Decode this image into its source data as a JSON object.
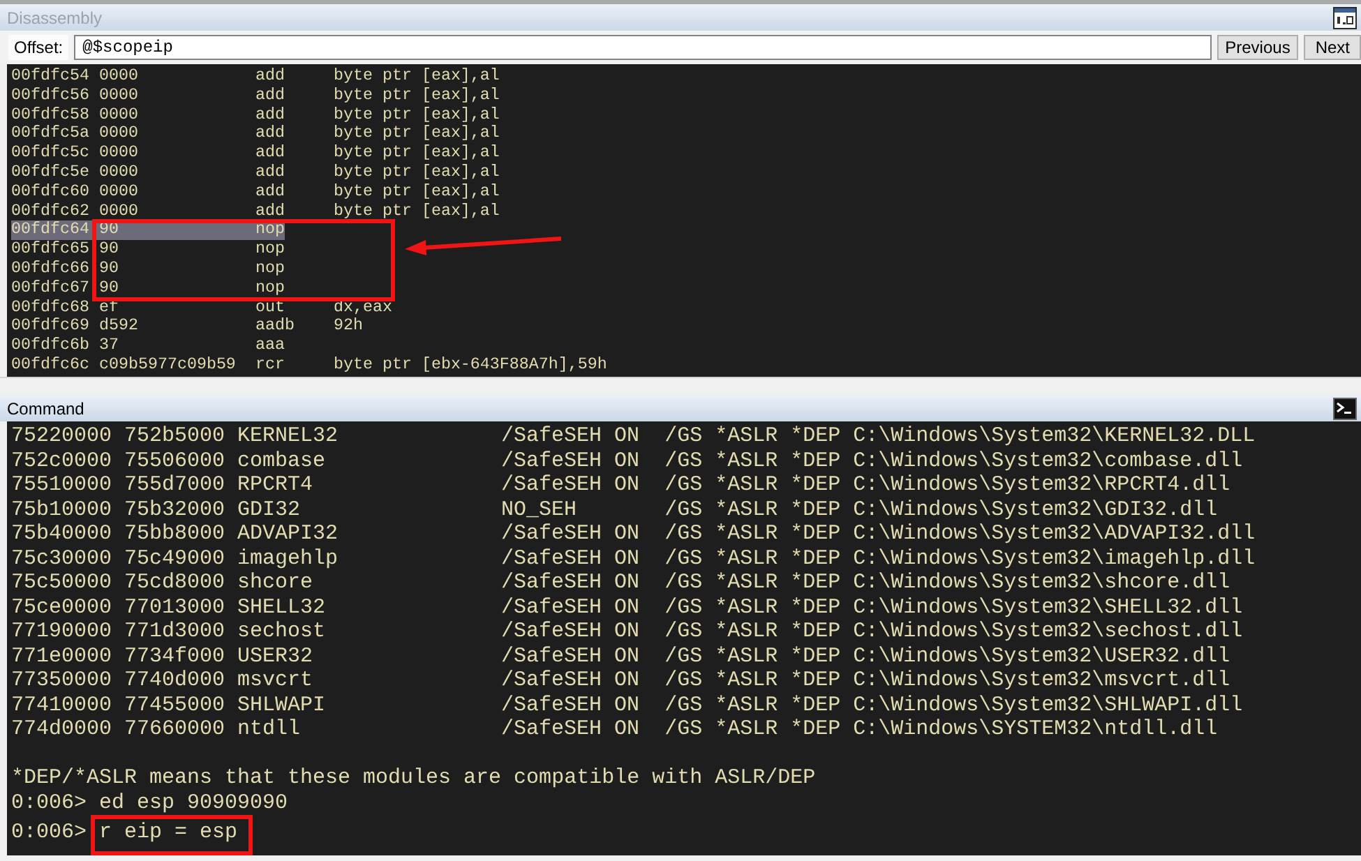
{
  "disassembly": {
    "title": "Disassembly",
    "active": false,
    "offset": {
      "label": "Offset:",
      "value": "@$scopeip"
    },
    "buttons": [
      "Previous",
      "Next"
    ],
    "callout_arrow": true,
    "rows": [
      {
        "address": "00fdfc54",
        "bytes": "0000",
        "mnemonic": "add",
        "operands": "byte ptr [eax],al",
        "selected": false,
        "boxed": false
      },
      {
        "address": "00fdfc56",
        "bytes": "0000",
        "mnemonic": "add",
        "operands": "byte ptr [eax],al",
        "selected": false,
        "boxed": false
      },
      {
        "address": "00fdfc58",
        "bytes": "0000",
        "mnemonic": "add",
        "operands": "byte ptr [eax],al",
        "selected": false,
        "boxed": false
      },
      {
        "address": "00fdfc5a",
        "bytes": "0000",
        "mnemonic": "add",
        "operands": "byte ptr [eax],al",
        "selected": false,
        "boxed": false
      },
      {
        "address": "00fdfc5c",
        "bytes": "0000",
        "mnemonic": "add",
        "operands": "byte ptr [eax],al",
        "selected": false,
        "boxed": false
      },
      {
        "address": "00fdfc5e",
        "bytes": "0000",
        "mnemonic": "add",
        "operands": "byte ptr [eax],al",
        "selected": false,
        "boxed": false
      },
      {
        "address": "00fdfc60",
        "bytes": "0000",
        "mnemonic": "add",
        "operands": "byte ptr [eax],al",
        "selected": false,
        "boxed": false
      },
      {
        "address": "00fdfc62",
        "bytes": "0000",
        "mnemonic": "add",
        "operands": "byte ptr [eax],al",
        "selected": false,
        "boxed": false
      },
      {
        "address": "00fdfc64",
        "bytes": "90",
        "mnemonic": "nop",
        "selected": true,
        "boxed": true
      },
      {
        "address": "00fdfc65",
        "bytes": "90",
        "mnemonic": "nop",
        "selected": false,
        "boxed": true
      },
      {
        "address": "00fdfc66",
        "bytes": "90",
        "mnemonic": "nop",
        "selected": false,
        "boxed": true
      },
      {
        "address": "00fdfc67",
        "bytes": "90",
        "mnemonic": "nop",
        "selected": false,
        "boxed": true
      },
      {
        "address": "00fdfc68",
        "bytes": "ef",
        "mnemonic": "out",
        "operands": "dx,eax",
        "selected": false,
        "boxed": false
      },
      {
        "address": "00fdfc69",
        "bytes": "d592",
        "mnemonic": "aadb",
        "operands": "92h",
        "selected": false,
        "boxed": false
      },
      {
        "address": "00fdfc6b",
        "bytes": "37",
        "mnemonic": "aaa",
        "selected": false,
        "boxed": false
      },
      {
        "address": "00fdfc6c",
        "bytes": "c09b5977c09b59",
        "mnemonic": "rcr",
        "operands": "byte ptr [ebx-643F88A7h],59h",
        "selected": false,
        "boxed": false
      }
    ]
  },
  "command": {
    "title": "Command",
    "active": true,
    "lines": [
      {
        "kind": "module",
        "start": "75220000",
        "end": "752b5000",
        "module": "KERNEL32",
        "safeseh": "/SafeSEH ON",
        "gs": "/GS",
        "aslr": "*ASLR",
        "dep": "*DEP",
        "path": "C:\\Windows\\System32\\KERNEL32.DLL"
      },
      {
        "kind": "module",
        "start": "752c0000",
        "end": "75506000",
        "module": "combase",
        "safeseh": "/SafeSEH ON",
        "gs": "/GS",
        "aslr": "*ASLR",
        "dep": "*DEP",
        "path": "C:\\Windows\\System32\\combase.dll"
      },
      {
        "kind": "module",
        "start": "75510000",
        "end": "755d7000",
        "module": "RPCRT4",
        "safeseh": "/SafeSEH ON",
        "gs": "/GS",
        "aslr": "*ASLR",
        "dep": "*DEP",
        "path": "C:\\Windows\\System32\\RPCRT4.dll"
      },
      {
        "kind": "module",
        "start": "75b10000",
        "end": "75b32000",
        "module": "GDI32",
        "safeseh": "NO_SEH",
        "gs": "/GS",
        "aslr": "*ASLR",
        "dep": "*DEP",
        "path": "C:\\Windows\\System32\\GDI32.dll"
      },
      {
        "kind": "module",
        "start": "75b40000",
        "end": "75bb8000",
        "module": "ADVAPI32",
        "safeseh": "/SafeSEH ON",
        "gs": "/GS",
        "aslr": "*ASLR",
        "dep": "*DEP",
        "path": "C:\\Windows\\System32\\ADVAPI32.dll"
      },
      {
        "kind": "module",
        "start": "75c30000",
        "end": "75c49000",
        "module": "imagehlp",
        "safeseh": "/SafeSEH ON",
        "gs": "/GS",
        "aslr": "*ASLR",
        "dep": "*DEP",
        "path": "C:\\Windows\\System32\\imagehlp.dll"
      },
      {
        "kind": "module",
        "start": "75c50000",
        "end": "75cd8000",
        "module": "shcore",
        "safeseh": "/SafeSEH ON",
        "gs": "/GS",
        "aslr": "*ASLR",
        "dep": "*DEP",
        "path": "C:\\Windows\\System32\\shcore.dll"
      },
      {
        "kind": "module",
        "start": "75ce0000",
        "end": "77013000",
        "module": "SHELL32",
        "safeseh": "/SafeSEH ON",
        "gs": "/GS",
        "aslr": "*ASLR",
        "dep": "*DEP",
        "path": "C:\\Windows\\System32\\SHELL32.dll"
      },
      {
        "kind": "module",
        "start": "77190000",
        "end": "771d3000",
        "module": "sechost",
        "safeseh": "/SafeSEH ON",
        "gs": "/GS",
        "aslr": "*ASLR",
        "dep": "*DEP",
        "path": "C:\\Windows\\System32\\sechost.dll"
      },
      {
        "kind": "module",
        "start": "771e0000",
        "end": "7734f000",
        "module": "USER32",
        "safeseh": "/SafeSEH ON",
        "gs": "/GS",
        "aslr": "*ASLR",
        "dep": "*DEP",
        "path": "C:\\Windows\\System32\\USER32.dll"
      },
      {
        "kind": "module",
        "start": "77350000",
        "end": "7740d000",
        "module": "msvcrt",
        "safeseh": "/SafeSEH ON",
        "gs": "/GS",
        "aslr": "*ASLR",
        "dep": "*DEP",
        "path": "C:\\Windows\\System32\\msvcrt.dll"
      },
      {
        "kind": "module",
        "start": "77410000",
        "end": "77455000",
        "module": "SHLWAPI",
        "safeseh": "/SafeSEH ON",
        "gs": "/GS",
        "aslr": "*ASLR",
        "dep": "*DEP",
        "path": "C:\\Windows\\System32\\SHLWAPI.dll"
      },
      {
        "kind": "module",
        "start": "774d0000",
        "end": "77660000",
        "module": "ntdll",
        "safeseh": "/SafeSEH ON",
        "gs": "/GS",
        "aslr": "*ASLR",
        "dep": "*DEP",
        "path": "C:\\Windows\\SYSTEM32\\ntdll.dll"
      },
      {
        "kind": "blank"
      },
      {
        "kind": "text",
        "text": "*DEP/*ASLR means that these modules are compatible with ASLR/DEP"
      },
      {
        "kind": "prompt",
        "prompt": "0:006>",
        "command": "ed esp 90909090",
        "boxed": false
      },
      {
        "kind": "prompt",
        "prompt": "0:006>",
        "command": "r eip = esp",
        "boxed": true
      }
    ]
  }
}
